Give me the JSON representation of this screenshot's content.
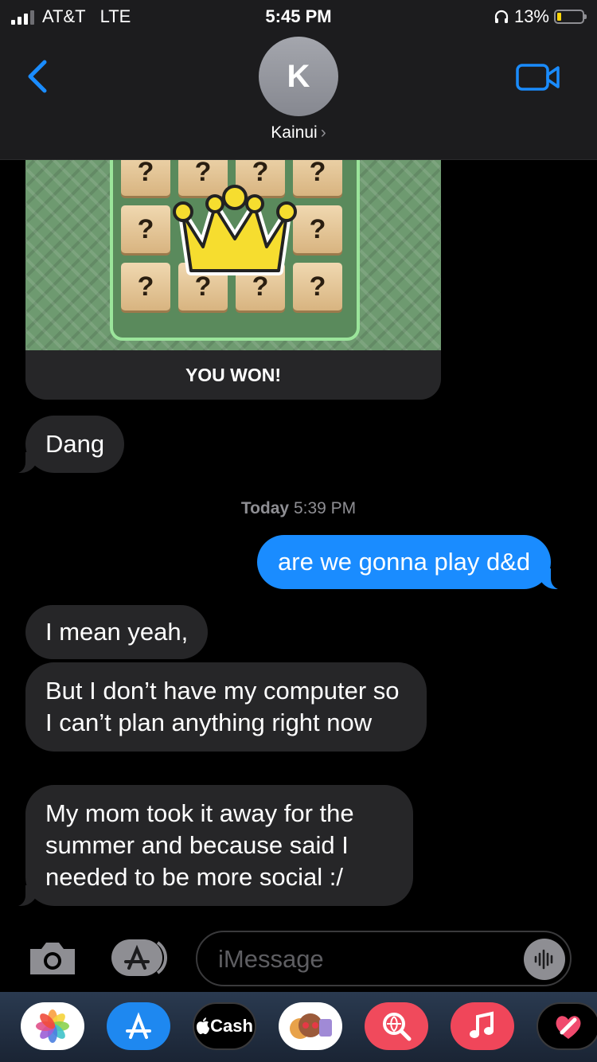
{
  "status_bar": {
    "carrier": "AT&T",
    "network": "LTE",
    "time": "5:45 PM",
    "battery_percent": "13%",
    "battery_level": 0.13,
    "icons": [
      "signal-icon",
      "headphones-icon",
      "battery-icon"
    ]
  },
  "header": {
    "avatar_initial": "K",
    "contact_name": "Kainui",
    "chevron": "›",
    "icons": [
      "back-chevron-icon",
      "video-camera-icon"
    ],
    "accent_color": "#1a8cff"
  },
  "game_card": {
    "tile_symbol": "?",
    "result_text": "YOU WON!",
    "icons": [
      "crown-icon"
    ]
  },
  "messages": [
    {
      "direction": "received",
      "text": "Dang"
    },
    {
      "direction": "sent",
      "text": "are we gonna play d&d"
    },
    {
      "direction": "received",
      "text": "I mean yeah,"
    },
    {
      "direction": "received",
      "text": "But I don’t have my computer so I can’t plan anything right now"
    },
    {
      "direction": "received",
      "text": "My mom took it away for the summer and because said I needed to be more social :/"
    }
  ],
  "timestamp": {
    "day": "Today",
    "time": "5:39 PM"
  },
  "input_bar": {
    "placeholder": "iMessage",
    "icons": [
      "camera-icon",
      "app-store-icon",
      "audio-waveform-icon"
    ]
  },
  "app_drawer": {
    "cash_label": "Cash",
    "apps": [
      "photos-icon",
      "app-store-icon",
      "apple-cash-icon",
      "memoji-icon",
      "image-search-icon",
      "music-icon",
      "digital-touch-icon"
    ]
  }
}
